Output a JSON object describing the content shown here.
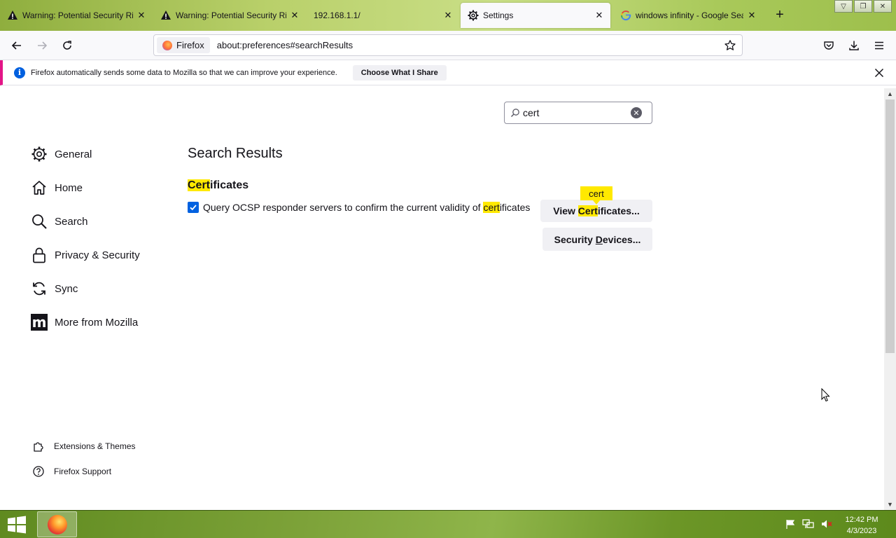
{
  "tabs": [
    {
      "title": "Warning: Potential Security Risk Ahead",
      "icon": "warning-icon"
    },
    {
      "title": "Warning: Potential Security Risk Ahead",
      "icon": "warning-icon"
    },
    {
      "title": "192.168.1.1/",
      "icon": ""
    },
    {
      "title": "Settings",
      "icon": "gear-icon",
      "active": true
    },
    {
      "title": "windows infinity - Google Search",
      "icon": "google-icon"
    }
  ],
  "urlbar": {
    "identity_label": "Firefox",
    "url": "about:preferences#searchResults"
  },
  "notification": {
    "text": "Firefox automatically sends some data to Mozilla so that we can improve your experience.",
    "button_label": "Choose What I Share"
  },
  "search": {
    "value": "cert"
  },
  "sidebar": {
    "items": [
      {
        "label": "General",
        "icon": "gear-icon"
      },
      {
        "label": "Home",
        "icon": "home-icon"
      },
      {
        "label": "Search",
        "icon": "search-icon"
      },
      {
        "label": "Privacy & Security",
        "icon": "lock-icon"
      },
      {
        "label": "Sync",
        "icon": "sync-icon"
      },
      {
        "label": "More from Mozilla",
        "icon": "mozilla-icon"
      }
    ],
    "bottom_items": [
      {
        "label": "Extensions & Themes",
        "icon": "puzzle-icon"
      },
      {
        "label": "Firefox Support",
        "icon": "help-icon"
      }
    ]
  },
  "main": {
    "title": "Search Results",
    "section": {
      "title_highlight": "Cert",
      "title_rest": "ificates",
      "checkbox": {
        "checked": true,
        "label_before": "Query OCSP responder servers to confirm the current validity of ",
        "label_highlight": "cert",
        "label_after": "ificates"
      },
      "view_button": {
        "prefix": "View ",
        "highlight": "Cert",
        "rest": "ificates..."
      },
      "security_button": {
        "before": "Security ",
        "accesskey": "D",
        "after": "evices..."
      },
      "tooltip": "cert"
    }
  },
  "taskbar": {
    "time": "12:42 PM",
    "date": "4/3/2023"
  },
  "colors": {
    "accent": "#0061e0",
    "highlight": "#ffe900",
    "notification_bar": "#e31587"
  }
}
